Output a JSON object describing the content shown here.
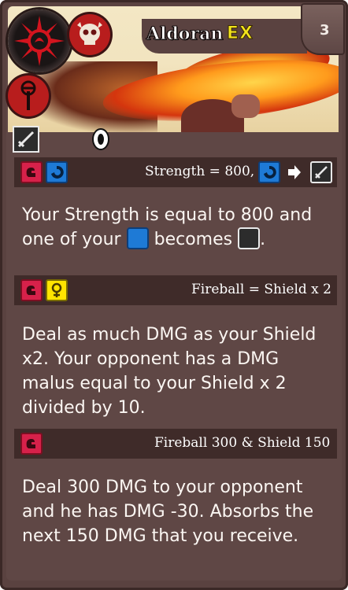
{
  "card": {
    "name": "Aldoran",
    "badge": "EX",
    "cost": "3"
  },
  "icons": {
    "emblem": "sunburst-icon",
    "race": "skull-icon",
    "class": "staff-icon",
    "weapon": "sword-icon",
    "ring": "ring-icon"
  },
  "abilities": [
    {
      "formula_pre": "Strength = 800,",
      "description_part1": "Your Strength is equal to 800 and one of your",
      "description_part2": "becomes",
      "description_end": "."
    },
    {
      "formula": "Fireball = Shield x 2",
      "description": "Deal as much DMG as your Shield x2. Your opponent has a DMG malus equal to your Shield x 2 divided by 10."
    },
    {
      "formula": "Fireball 300 & Shield 150",
      "description": "Deal 300 DMG to your opponent and he has DMG -30. Absorbs the next 150 DMG that you receive."
    }
  ],
  "colors": {
    "card_bg": "#5f4745",
    "section_bar": "#3f2b29",
    "red_icon": "#d7214a",
    "blue_icon": "#1e7ad6",
    "yellow_icon": "#ffe400",
    "ex_yellow": "#f4e51c"
  }
}
